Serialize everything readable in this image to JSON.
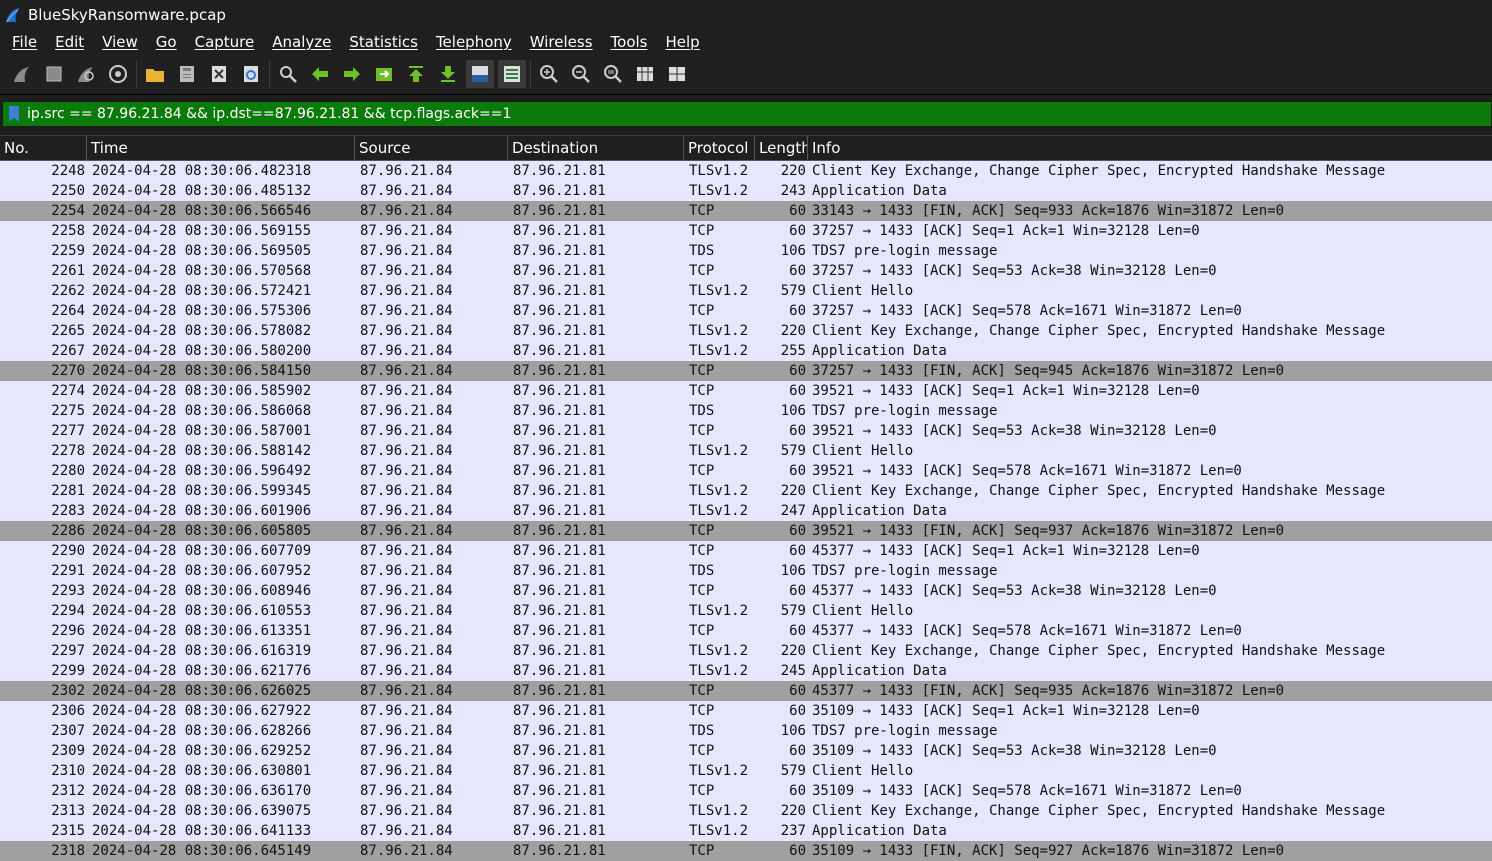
{
  "window": {
    "title": "BlueSkyRansomware.pcap"
  },
  "menu": [
    "File",
    "Edit",
    "View",
    "Go",
    "Capture",
    "Analyze",
    "Statistics",
    "Telephony",
    "Wireless",
    "Tools",
    "Help"
  ],
  "toolbar_icons": [
    "shark-fin-start-icon",
    "stop-icon",
    "restart-icon",
    "capture-options-icon",
    "open-file-icon",
    "save-file-icon",
    "close-file-icon",
    "reload-icon",
    "find-icon",
    "go-back-icon",
    "go-forward-icon",
    "go-to-packet-icon",
    "first-packet-icon",
    "last-packet-icon",
    "auto-scroll-icon",
    "colorize-icon",
    "zoom-in-icon",
    "zoom-out-icon",
    "normal-size-icon",
    "resize-columns-icon"
  ],
  "filter": {
    "value": "ip.src == 87.96.21.84 && ip.dst==87.96.21.81 && tcp.flags.ack==1"
  },
  "columns": {
    "no": "No.",
    "time": "Time",
    "source": "Source",
    "destination": "Destination",
    "protocol": "Protocol",
    "length": "Length",
    "info": "Info"
  },
  "colors": {
    "row_default": "#e7e6ff",
    "row_fin": "#a0a0a0",
    "filter_valid": "#0a7a0a"
  },
  "packets": [
    {
      "no": "2248",
      "time": "2024-04-28 08:30:06.482318",
      "src": "87.96.21.84",
      "dst": "87.96.21.81",
      "proto": "TLSv1.2",
      "len": "220",
      "info": "Client Key Exchange, Change Cipher Spec, Encrypted Handshake Message",
      "fin": false
    },
    {
      "no": "2250",
      "time": "2024-04-28 08:30:06.485132",
      "src": "87.96.21.84",
      "dst": "87.96.21.81",
      "proto": "TLSv1.2",
      "len": "243",
      "info": "Application Data",
      "fin": false
    },
    {
      "no": "2254",
      "time": "2024-04-28 08:30:06.566546",
      "src": "87.96.21.84",
      "dst": "87.96.21.81",
      "proto": "TCP",
      "len": "60",
      "info": "33143 → 1433 [FIN, ACK] Seq=933 Ack=1876 Win=31872 Len=0",
      "fin": true
    },
    {
      "no": "2258",
      "time": "2024-04-28 08:30:06.569155",
      "src": "87.96.21.84",
      "dst": "87.96.21.81",
      "proto": "TCP",
      "len": "60",
      "info": "37257 → 1433 [ACK] Seq=1 Ack=1 Win=32128 Len=0",
      "fin": false
    },
    {
      "no": "2259",
      "time": "2024-04-28 08:30:06.569505",
      "src": "87.96.21.84",
      "dst": "87.96.21.81",
      "proto": "TDS",
      "len": "106",
      "info": "TDS7 pre-login message",
      "fin": false
    },
    {
      "no": "2261",
      "time": "2024-04-28 08:30:06.570568",
      "src": "87.96.21.84",
      "dst": "87.96.21.81",
      "proto": "TCP",
      "len": "60",
      "info": "37257 → 1433 [ACK] Seq=53 Ack=38 Win=32128 Len=0",
      "fin": false
    },
    {
      "no": "2262",
      "time": "2024-04-28 08:30:06.572421",
      "src": "87.96.21.84",
      "dst": "87.96.21.81",
      "proto": "TLSv1.2",
      "len": "579",
      "info": "Client Hello",
      "fin": false
    },
    {
      "no": "2264",
      "time": "2024-04-28 08:30:06.575306",
      "src": "87.96.21.84",
      "dst": "87.96.21.81",
      "proto": "TCP",
      "len": "60",
      "info": "37257 → 1433 [ACK] Seq=578 Ack=1671 Win=31872 Len=0",
      "fin": false
    },
    {
      "no": "2265",
      "time": "2024-04-28 08:30:06.578082",
      "src": "87.96.21.84",
      "dst": "87.96.21.81",
      "proto": "TLSv1.2",
      "len": "220",
      "info": "Client Key Exchange, Change Cipher Spec, Encrypted Handshake Message",
      "fin": false
    },
    {
      "no": "2267",
      "time": "2024-04-28 08:30:06.580200",
      "src": "87.96.21.84",
      "dst": "87.96.21.81",
      "proto": "TLSv1.2",
      "len": "255",
      "info": "Application Data",
      "fin": false
    },
    {
      "no": "2270",
      "time": "2024-04-28 08:30:06.584150",
      "src": "87.96.21.84",
      "dst": "87.96.21.81",
      "proto": "TCP",
      "len": "60",
      "info": "37257 → 1433 [FIN, ACK] Seq=945 Ack=1876 Win=31872 Len=0",
      "fin": true
    },
    {
      "no": "2274",
      "time": "2024-04-28 08:30:06.585902",
      "src": "87.96.21.84",
      "dst": "87.96.21.81",
      "proto": "TCP",
      "len": "60",
      "info": "39521 → 1433 [ACK] Seq=1 Ack=1 Win=32128 Len=0",
      "fin": false
    },
    {
      "no": "2275",
      "time": "2024-04-28 08:30:06.586068",
      "src": "87.96.21.84",
      "dst": "87.96.21.81",
      "proto": "TDS",
      "len": "106",
      "info": "TDS7 pre-login message",
      "fin": false
    },
    {
      "no": "2277",
      "time": "2024-04-28 08:30:06.587001",
      "src": "87.96.21.84",
      "dst": "87.96.21.81",
      "proto": "TCP",
      "len": "60",
      "info": "39521 → 1433 [ACK] Seq=53 Ack=38 Win=32128 Len=0",
      "fin": false
    },
    {
      "no": "2278",
      "time": "2024-04-28 08:30:06.588142",
      "src": "87.96.21.84",
      "dst": "87.96.21.81",
      "proto": "TLSv1.2",
      "len": "579",
      "info": "Client Hello",
      "fin": false
    },
    {
      "no": "2280",
      "time": "2024-04-28 08:30:06.596492",
      "src": "87.96.21.84",
      "dst": "87.96.21.81",
      "proto": "TCP",
      "len": "60",
      "info": "39521 → 1433 [ACK] Seq=578 Ack=1671 Win=31872 Len=0",
      "fin": false
    },
    {
      "no": "2281",
      "time": "2024-04-28 08:30:06.599345",
      "src": "87.96.21.84",
      "dst": "87.96.21.81",
      "proto": "TLSv1.2",
      "len": "220",
      "info": "Client Key Exchange, Change Cipher Spec, Encrypted Handshake Message",
      "fin": false
    },
    {
      "no": "2283",
      "time": "2024-04-28 08:30:06.601906",
      "src": "87.96.21.84",
      "dst": "87.96.21.81",
      "proto": "TLSv1.2",
      "len": "247",
      "info": "Application Data",
      "fin": false
    },
    {
      "no": "2286",
      "time": "2024-04-28 08:30:06.605805",
      "src": "87.96.21.84",
      "dst": "87.96.21.81",
      "proto": "TCP",
      "len": "60",
      "info": "39521 → 1433 [FIN, ACK] Seq=937 Ack=1876 Win=31872 Len=0",
      "fin": true
    },
    {
      "no": "2290",
      "time": "2024-04-28 08:30:06.607709",
      "src": "87.96.21.84",
      "dst": "87.96.21.81",
      "proto": "TCP",
      "len": "60",
      "info": "45377 → 1433 [ACK] Seq=1 Ack=1 Win=32128 Len=0",
      "fin": false
    },
    {
      "no": "2291",
      "time": "2024-04-28 08:30:06.607952",
      "src": "87.96.21.84",
      "dst": "87.96.21.81",
      "proto": "TDS",
      "len": "106",
      "info": "TDS7 pre-login message",
      "fin": false
    },
    {
      "no": "2293",
      "time": "2024-04-28 08:30:06.608946",
      "src": "87.96.21.84",
      "dst": "87.96.21.81",
      "proto": "TCP",
      "len": "60",
      "info": "45377 → 1433 [ACK] Seq=53 Ack=38 Win=32128 Len=0",
      "fin": false
    },
    {
      "no": "2294",
      "time": "2024-04-28 08:30:06.610553",
      "src": "87.96.21.84",
      "dst": "87.96.21.81",
      "proto": "TLSv1.2",
      "len": "579",
      "info": "Client Hello",
      "fin": false
    },
    {
      "no": "2296",
      "time": "2024-04-28 08:30:06.613351",
      "src": "87.96.21.84",
      "dst": "87.96.21.81",
      "proto": "TCP",
      "len": "60",
      "info": "45377 → 1433 [ACK] Seq=578 Ack=1671 Win=31872 Len=0",
      "fin": false
    },
    {
      "no": "2297",
      "time": "2024-04-28 08:30:06.616319",
      "src": "87.96.21.84",
      "dst": "87.96.21.81",
      "proto": "TLSv1.2",
      "len": "220",
      "info": "Client Key Exchange, Change Cipher Spec, Encrypted Handshake Message",
      "fin": false
    },
    {
      "no": "2299",
      "time": "2024-04-28 08:30:06.621776",
      "src": "87.96.21.84",
      "dst": "87.96.21.81",
      "proto": "TLSv1.2",
      "len": "245",
      "info": "Application Data",
      "fin": false
    },
    {
      "no": "2302",
      "time": "2024-04-28 08:30:06.626025",
      "src": "87.96.21.84",
      "dst": "87.96.21.81",
      "proto": "TCP",
      "len": "60",
      "info": "45377 → 1433 [FIN, ACK] Seq=935 Ack=1876 Win=31872 Len=0",
      "fin": true
    },
    {
      "no": "2306",
      "time": "2024-04-28 08:30:06.627922",
      "src": "87.96.21.84",
      "dst": "87.96.21.81",
      "proto": "TCP",
      "len": "60",
      "info": "35109 → 1433 [ACK] Seq=1 Ack=1 Win=32128 Len=0",
      "fin": false
    },
    {
      "no": "2307",
      "time": "2024-04-28 08:30:06.628266",
      "src": "87.96.21.84",
      "dst": "87.96.21.81",
      "proto": "TDS",
      "len": "106",
      "info": "TDS7 pre-login message",
      "fin": false
    },
    {
      "no": "2309",
      "time": "2024-04-28 08:30:06.629252",
      "src": "87.96.21.84",
      "dst": "87.96.21.81",
      "proto": "TCP",
      "len": "60",
      "info": "35109 → 1433 [ACK] Seq=53 Ack=38 Win=32128 Len=0",
      "fin": false
    },
    {
      "no": "2310",
      "time": "2024-04-28 08:30:06.630801",
      "src": "87.96.21.84",
      "dst": "87.96.21.81",
      "proto": "TLSv1.2",
      "len": "579",
      "info": "Client Hello",
      "fin": false
    },
    {
      "no": "2312",
      "time": "2024-04-28 08:30:06.636170",
      "src": "87.96.21.84",
      "dst": "87.96.21.81",
      "proto": "TCP",
      "len": "60",
      "info": "35109 → 1433 [ACK] Seq=578 Ack=1671 Win=31872 Len=0",
      "fin": false
    },
    {
      "no": "2313",
      "time": "2024-04-28 08:30:06.639075",
      "src": "87.96.21.84",
      "dst": "87.96.21.81",
      "proto": "TLSv1.2",
      "len": "220",
      "info": "Client Key Exchange, Change Cipher Spec, Encrypted Handshake Message",
      "fin": false
    },
    {
      "no": "2315",
      "time": "2024-04-28 08:30:06.641133",
      "src": "87.96.21.84",
      "dst": "87.96.21.81",
      "proto": "TLSv1.2",
      "len": "237",
      "info": "Application Data",
      "fin": false
    },
    {
      "no": "2318",
      "time": "2024-04-28 08:30:06.645149",
      "src": "87.96.21.84",
      "dst": "87.96.21.81",
      "proto": "TCP",
      "len": "60",
      "info": "35109 → 1433 [FIN, ACK] Seq=927 Ack=1876 Win=31872 Len=0",
      "fin": true
    }
  ]
}
